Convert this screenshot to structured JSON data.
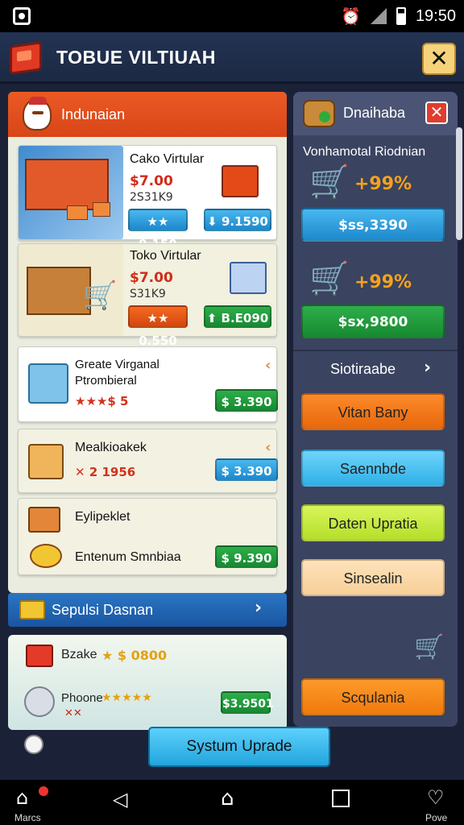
{
  "status_bar": {
    "time": "19:50",
    "alarm_icon": "alarm-icon",
    "signal_icon": "signal-icon",
    "battery_icon": "battery-icon"
  },
  "title_bar": {
    "title": "TOBUE VILTIUAH",
    "close_label": "✕"
  },
  "left_panel": {
    "header_title": "Indunaian",
    "cards": [
      {
        "name": "Cako Virtular",
        "price": "$7.00",
        "code": "2S31K9",
        "btn1": "★★ 9.150",
        "btn2": "⬇ 9.1590"
      },
      {
        "name": "Toko Virtular",
        "price": "$7.00",
        "code": "S31K9",
        "btn1": "★★ 0.550",
        "btn2": "⬆ B.E090"
      },
      {
        "name": "Greate Virganal Ptrombieral",
        "stars": "★★★$ 5",
        "btn": "$ 3.390"
      },
      {
        "name": "Mealkioakek",
        "code": "✕ 2 1956",
        "btn": "$ 3.390"
      },
      {
        "name": "Eylipeklet",
        "sub": "Entenum Smnbiaa",
        "btn": "$ 9.390"
      }
    ]
  },
  "feature_bar": {
    "title": "Sepulsi Dasnan",
    "chevron": "›"
  },
  "bottom_panel": {
    "item1": {
      "name": "Bzake",
      "stars": "★ $ 0800"
    },
    "item2": {
      "name": "Phoone",
      "stars": "★★★★★",
      "mark": "✕✕",
      "btn": "$3.9501"
    }
  },
  "upgrade_button": "Systum Uprade",
  "right_panel": {
    "header_title": "Dnaihaba",
    "close_label": "✕",
    "subtitle": "Vonhamotal Riodnian",
    "deal1": {
      "discount": "+99%",
      "btn": "$ss,3390"
    },
    "deal2": {
      "discount": "+99%",
      "btn": "$sx,9800"
    },
    "section_title": "Siotiraabe",
    "section_chevron": "›",
    "menu": [
      "Vitan Bany",
      "Saennbde",
      "Daten Upratia",
      "Sinsealin",
      "Scqulania"
    ]
  },
  "nav_bar": {
    "home_label": "Marcs",
    "fav_label": "Pove"
  },
  "colors": {
    "accent_orange": "#e84f1e",
    "blue": "#1e88cc",
    "green": "#178a31",
    "panel": "#3a4360"
  }
}
